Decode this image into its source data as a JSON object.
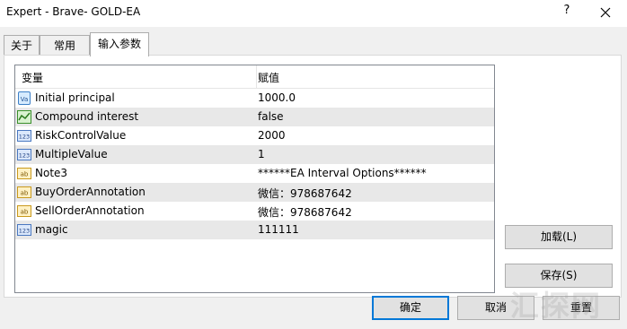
{
  "window": {
    "title": "Expert - Brave- GOLD-EA",
    "help_label": "?"
  },
  "tabs": [
    {
      "label": "关于"
    },
    {
      "label": "常用"
    },
    {
      "label": "输入参数"
    }
  ],
  "grid": {
    "headers": {
      "variable": "变量",
      "value": "赋值"
    },
    "rows": [
      {
        "icon": "value-tag-icon",
        "name": "Initial principal",
        "value": "1000.0"
      },
      {
        "icon": "trend-chart-icon",
        "name": "Compound interest",
        "value": "false"
      },
      {
        "icon": "integer-icon",
        "name": "RiskControlValue",
        "value": "2000"
      },
      {
        "icon": "integer-icon",
        "name": "MultipleValue",
        "value": "1"
      },
      {
        "icon": "string-icon",
        "name": "Note3",
        "value": "******EA Interval Options******"
      },
      {
        "icon": "string-icon",
        "name": "BuyOrderAnnotation",
        "value": "微信：978687642"
      },
      {
        "icon": "string-icon",
        "name": "SellOrderAnnotation",
        "value": "微信：978687642"
      },
      {
        "icon": "integer-icon",
        "name": "magic",
        "value": "111111"
      }
    ]
  },
  "buttons": {
    "load": "加载(L)",
    "save": "保存(S)",
    "ok": "确定",
    "cancel": "取消",
    "reset": "重置"
  },
  "watermark": "汇探网",
  "colors": {
    "accent": "#0078d7",
    "row_alt": "#e8e8e8",
    "window_bg": "#f0f0f0"
  }
}
